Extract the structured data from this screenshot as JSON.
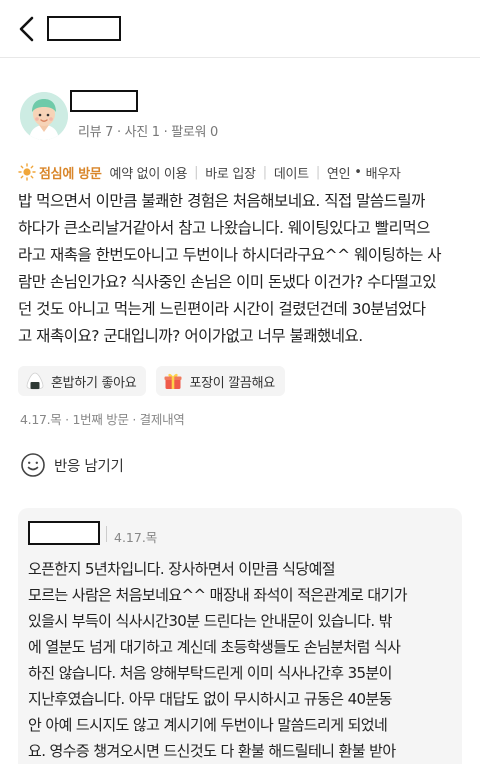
{
  "header": {
    "back_icon": "chevron-left-icon"
  },
  "reviewer": {
    "stats": "리뷰 7 · 사진 1 · 팔로워 0"
  },
  "tags": {
    "highlight": "점심에 방문",
    "items": [
      "예약 없이 이용",
      "바로 입장",
      "데이트"
    ],
    "companion_a": "연인",
    "companion_sep": "•",
    "companion_b": "배우자",
    "accent_color": "#d9862a"
  },
  "review": {
    "text": "밥 먹으면서 이만큼 불쾌한 경험은 처음해보네요. 직접 말씀드릴까\n하다가 큰소리날거같아서 참고 나왔습니다. 웨이팅있다고 빨리먹으\n라고 재촉을 한번도아니고 두번이나 하시더라구요^^ 웨이팅하는 사\n람만 손님인가요? 식사중인 손님은 이미 돈냈다 이건가? 수다떨고있\n던 것도 아니고 먹는게 느린편이라 시간이 걸렸던건데 30분넘었다\n고 재촉이요? 군대입니까? 어이가없고 너무 불쾌했네요."
  },
  "chips": [
    {
      "icon": "rice-ball-icon",
      "label": "혼밥하기 좋아요"
    },
    {
      "icon": "gift-box-icon",
      "label": "포장이 깔끔해요"
    }
  ],
  "meta": "4.17.목 · 1번째 방문 · 결제내역",
  "reaction": {
    "icon": "smiley-icon",
    "label": "반응 남기기"
  },
  "owner_reply": {
    "date": "4.17.목",
    "text": "오픈한지 5년차입니다. 장사하면서 이만큼 식당예절\n모르는 사람은 처음보네요^^ 매장내 좌석이 적은관계로 대기가\n있을시 부득이 식사시간30분 드린다는 안내문이 있습니다. 밖\n에 열분도 넘게 대기하고 계신데 초등학생들도 손님분처럼 식사\n하진 않습니다. 처음 양해부탁드린게 이미 식사나간후 35분이\n지난후였습니다. 아무 대답도 없이 무시하시고 규동은 40분동\n안 아예 드시지도 않고 계시기에 두번이나 말씀드리게 되었네\n요. 영수증 챙겨오시면 드신것도 다 환불 해드릴테니 환불 받아"
  }
}
